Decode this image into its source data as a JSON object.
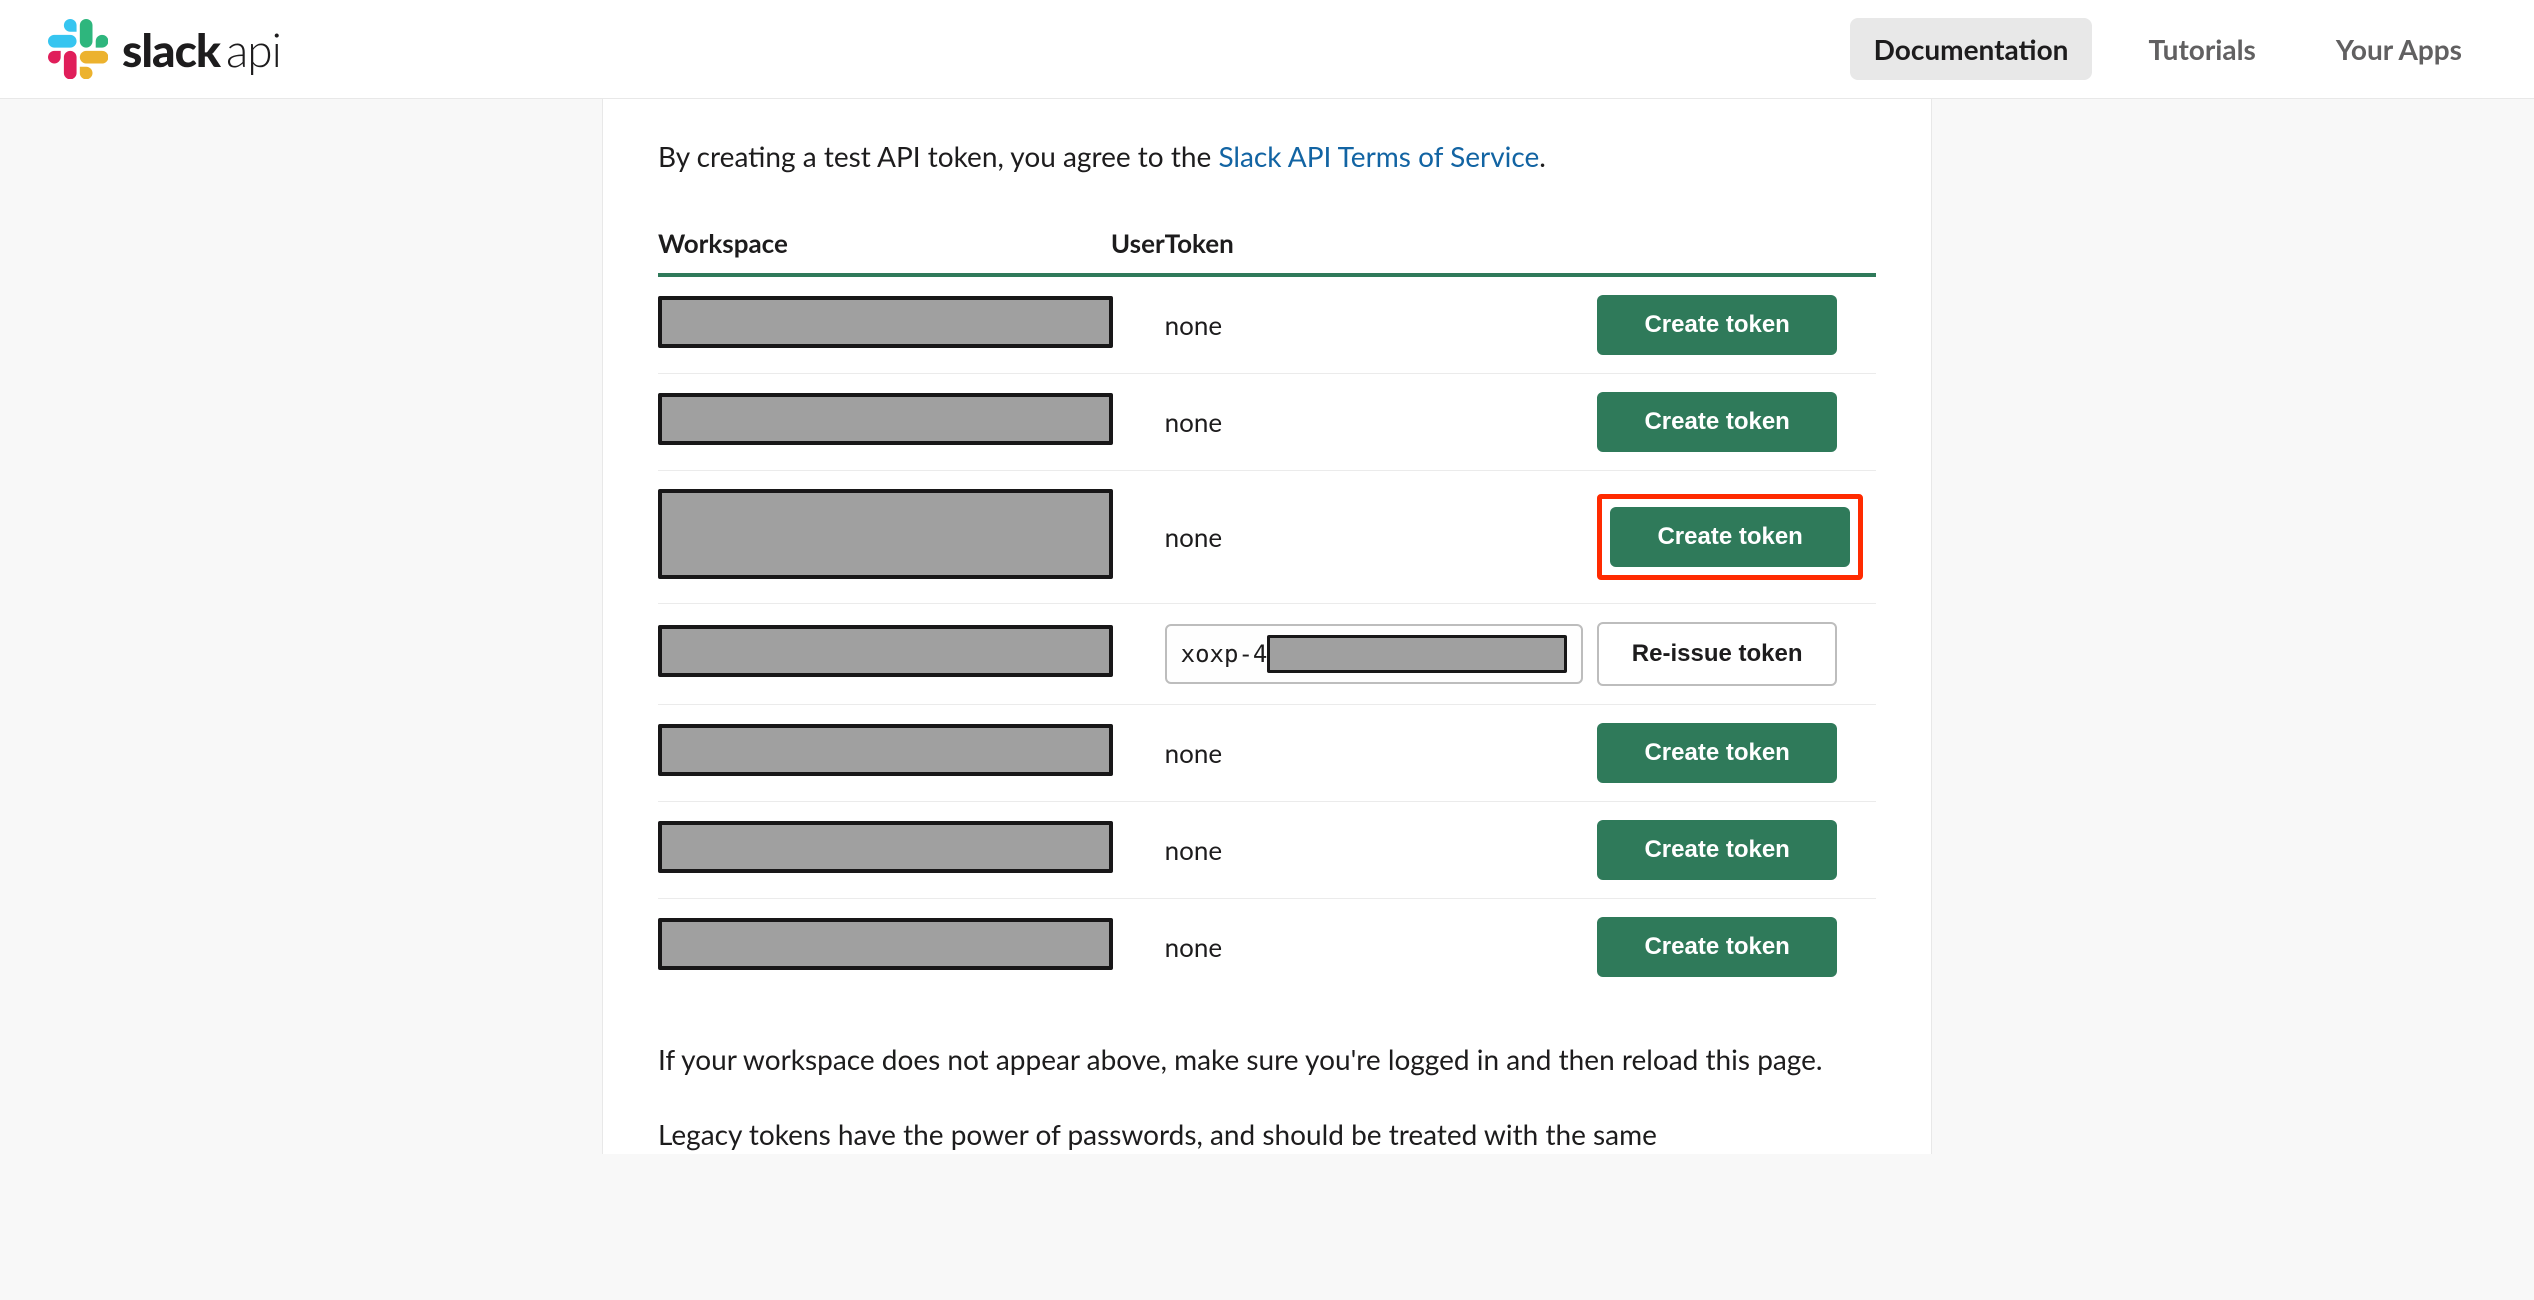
{
  "brand": {
    "name": "slack",
    "suffix": "api"
  },
  "nav": {
    "documentation": "Documentation",
    "tutorials": "Tutorials",
    "your_apps": "Your Apps"
  },
  "intro": {
    "prefix": "By creating a test API token, you agree to the ",
    "link": "Slack API Terms of Service",
    "suffix": "."
  },
  "table": {
    "headers": {
      "workspace": "Workspace",
      "user": "User",
      "token": "Token",
      "action": ""
    },
    "rows": [
      {
        "token": "none",
        "action_label": "Create token",
        "action_style": "green",
        "highlighted": false,
        "tall": false
      },
      {
        "token": "none",
        "action_label": "Create token",
        "action_style": "green",
        "highlighted": false,
        "tall": false
      },
      {
        "token": "none",
        "action_label": "Create token",
        "action_style": "green",
        "highlighted": true,
        "tall": true
      },
      {
        "token": "xoxp-4",
        "action_label": "Re-issue token",
        "action_style": "outline",
        "highlighted": false,
        "tall": false,
        "has_token_box": true
      },
      {
        "token": "none",
        "action_label": "Create token",
        "action_style": "green",
        "highlighted": false,
        "tall": false
      },
      {
        "token": "none",
        "action_label": "Create token",
        "action_style": "green",
        "highlighted": false,
        "tall": false
      },
      {
        "token": "none",
        "action_label": "Create token",
        "action_style": "green",
        "highlighted": false,
        "tall": false
      }
    ]
  },
  "notes": {
    "p1": "If your workspace does not appear above, make sure you're logged in and then reload this page.",
    "p2": "Legacy tokens have the power of passwords, and should be treated with the same"
  }
}
